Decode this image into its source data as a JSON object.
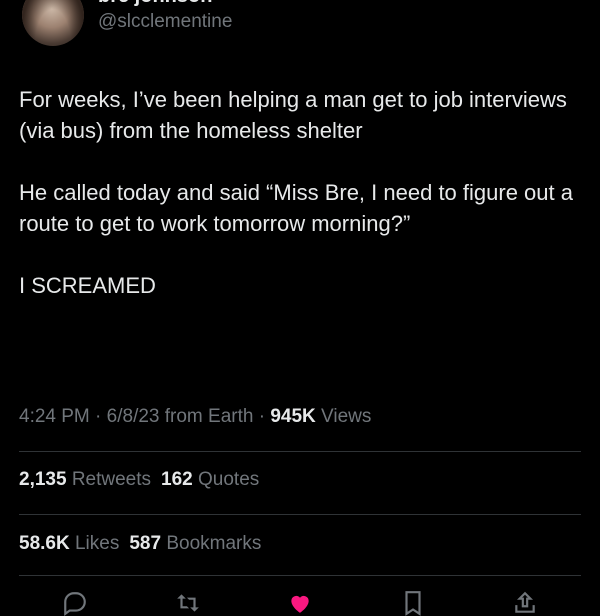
{
  "author": {
    "display_name": "bre johnson",
    "handle": "@slcclementine"
  },
  "tweet": {
    "line1": "For weeks, I’ve been helping a man get to job interviews (via bus) from the homeless shelter",
    "line2": "He called today and said “Miss Bre, I need to figure out a route to get to work tomorrow morning?”",
    "line3": "I SCREAMED"
  },
  "meta": {
    "time": "4:24 PM",
    "sep1": " · ",
    "date": "6/8/23",
    "source": " from Earth",
    "sep2": " · ",
    "views_count": "945K",
    "views_label": " Views"
  },
  "stats": {
    "retweets_count": "2,135",
    "retweets_label": " Retweets",
    "quotes_count": "162",
    "quotes_label": " Quotes",
    "likes_count": "58.6K",
    "likes_label": " Likes",
    "bookmarks_count": "587",
    "bookmarks_label": " Bookmarks"
  },
  "actions": {
    "reply_icon": "reply-icon",
    "retweet_icon": "retweet-icon",
    "like_icon": "heart-icon",
    "bookmark_icon": "bookmark-icon",
    "share_icon": "share-icon",
    "like_color": "#f91880"
  }
}
